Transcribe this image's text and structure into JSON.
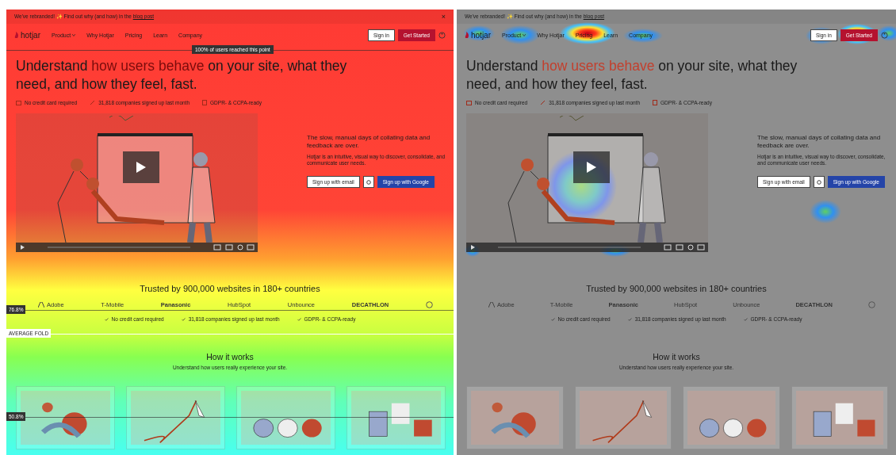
{
  "panels": [
    {
      "kind": "scroll",
      "page": {
        "banner": {
          "text": "We've rebranded! ✨ Find out why (and how) in the",
          "link": "blog post",
          "dismiss": "×"
        },
        "logo": "hotjar",
        "nav": [
          {
            "label": "Product",
            "dropdown": true
          },
          {
            "label": "Why Hotjar",
            "dropdown": false
          },
          {
            "label": "Pricing",
            "dropdown": false
          },
          {
            "label": "Learn",
            "dropdown": false
          },
          {
            "label": "Company",
            "dropdown": false
          }
        ],
        "sign_in": "Sign in",
        "get_started": "Get Started",
        "headline": [
          {
            "text": "Understand ",
            "accent": false
          },
          {
            "text": "how users behave",
            "accent": true
          },
          {
            "text": " on your site, what they need, and how they feel, fast.",
            "accent": false
          }
        ],
        "badges": [
          "No credit card required",
          "31,818 companies signed up last month",
          "GDPR- & CCPA-ready"
        ],
        "side_title": "The slow, manual days of collating data and feedback are over.",
        "side_text": "Hotjar is an intuitive, visual way to discover, consolidate, and communicate user needs.",
        "email_button": "Sign up with email",
        "google_button": "Sign up with Google",
        "trusted": "Trusted by 900,000 websites in 180+ countries",
        "logos": [
          "Adobe",
          "T-Mobile",
          "Panasonic",
          "HubSpot",
          "Unbounce",
          "DECATHLON"
        ],
        "checks": [
          "No credit card required",
          "31,818 companies signed up last month",
          "GDPR- & CCPA-ready"
        ],
        "how_title": "How it works",
        "how_subtitle": "Understand how users really experience your site."
      },
      "markers": [
        {
          "kind": "callout",
          "label": "100% of users reached this point"
        },
        {
          "kind": "tab",
          "label": "76.8%"
        },
        {
          "kind": "fold",
          "label": "AVERAGE FOLD"
        },
        {
          "kind": "tab",
          "label": "50.8%"
        }
      ]
    },
    {
      "kind": "click",
      "page": {
        "banner": {
          "text": "We've rebranded! ✨ Find out why (and how) in the",
          "link": "blog post"
        },
        "logo": "hotjar",
        "nav": [
          {
            "label": "Product",
            "dropdown": true
          },
          {
            "label": "Why Hotjar",
            "dropdown": false
          },
          {
            "label": "Pricing",
            "dropdown": false
          },
          {
            "label": "Learn",
            "dropdown": false
          },
          {
            "label": "Company",
            "dropdown": false
          }
        ],
        "sign_in": "Sign in",
        "get_started": "Get Started",
        "headline": [
          {
            "text": "Understand ",
            "accent": false
          },
          {
            "text": "how users behave",
            "accent": true
          },
          {
            "text": " on your site, what they need, and how they feel, fast.",
            "accent": false
          }
        ],
        "badges": [
          "No credit card required",
          "31,818 companies signed up last month",
          "GDPR- & CCPA-ready"
        ],
        "side_title": "The slow, manual days of collating data and feedback are over.",
        "side_text": "Hotjar is an intuitive, visual way to discover, consolidate, and communicate user needs.",
        "email_button": "Sign up with email",
        "google_button": "Sign up with Google",
        "trusted": "Trusted by 900,000 websites in 180+ countries",
        "logos": [
          "Adobe",
          "T-Mobile",
          "Panasonic",
          "HubSpot",
          "Unbounce",
          "DECATHLON"
        ],
        "checks": [
          "No credit card required",
          "31,818 companies signed up last month",
          "GDPR- & CCPA-ready"
        ],
        "how_title": "How it works",
        "how_subtitle": "Understand how users really experience your site."
      }
    }
  ]
}
